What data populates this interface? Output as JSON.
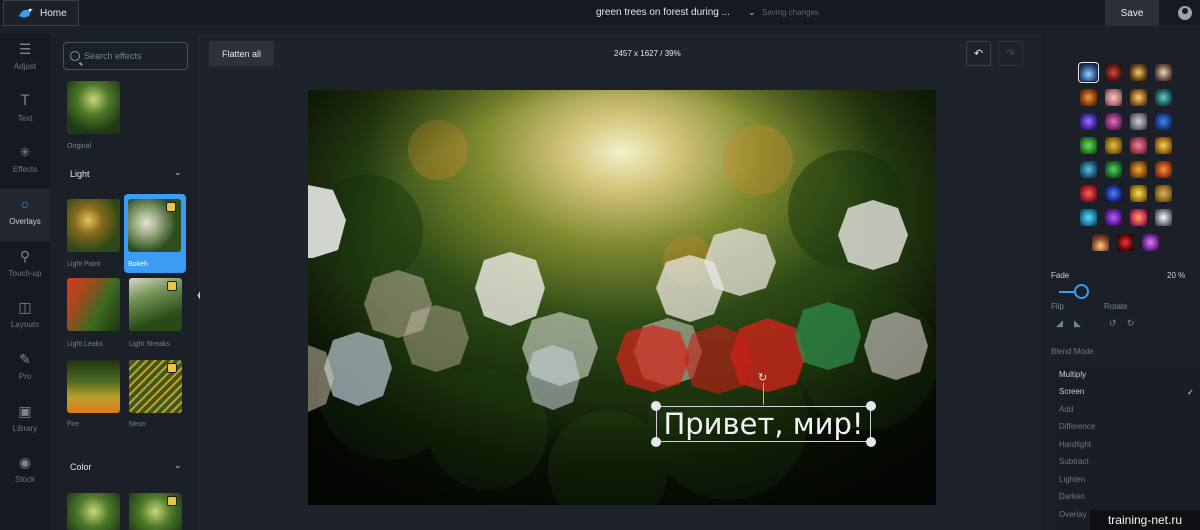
{
  "header": {
    "home_label": "Home",
    "doc_title": "green trees on forest during ...",
    "status": "Saving changes",
    "save_label": "Save"
  },
  "sidebar": {
    "items": [
      {
        "label": "Adjust",
        "icon": "sliders-icon"
      },
      {
        "label": "Text",
        "icon": "text-icon"
      },
      {
        "label": "Effects",
        "icon": "sparkle-icon"
      },
      {
        "label": "Overlays",
        "icon": "ring-icon",
        "active": true
      },
      {
        "label": "Touch-up",
        "icon": "brush-icon"
      },
      {
        "label": "Layouts",
        "icon": "layout-icon"
      },
      {
        "label": "Pro",
        "icon": "pen-icon"
      },
      {
        "label": "Library",
        "icon": "image-icon"
      },
      {
        "label": "Stock",
        "icon": "camera-icon"
      }
    ]
  },
  "effects": {
    "search_placeholder": "Search effects",
    "original_label": "Original",
    "section_light": "Light",
    "section_color": "Color",
    "light_items": [
      "Light Paint",
      "Bokeh",
      "Light Leaks",
      "Light Streaks",
      "Fire",
      "Neon"
    ],
    "selected": "Bokeh"
  },
  "canvas": {
    "flatten_label": "Flatten all",
    "dimensions": "2457 x 1627 / 39%",
    "text_layer": "Привет, мир!"
  },
  "properties": {
    "fade_label": "Fade",
    "fade_value": "20 %",
    "fade_fraction": 0.2,
    "flip_label": "Flip",
    "rotate_label": "Rotate",
    "blend_mode_label": "Blend Mode",
    "blend_modes": [
      "Multiply",
      "Screen",
      "Add",
      "Difference",
      "Hardlight",
      "Subtract",
      "Lighten",
      "Darken",
      "Overlay"
    ],
    "selected_blend": "Screen"
  },
  "watermark": "training-net.ru",
  "colors": {
    "accent": "#3b9cf5",
    "background": "#1b1f27"
  }
}
